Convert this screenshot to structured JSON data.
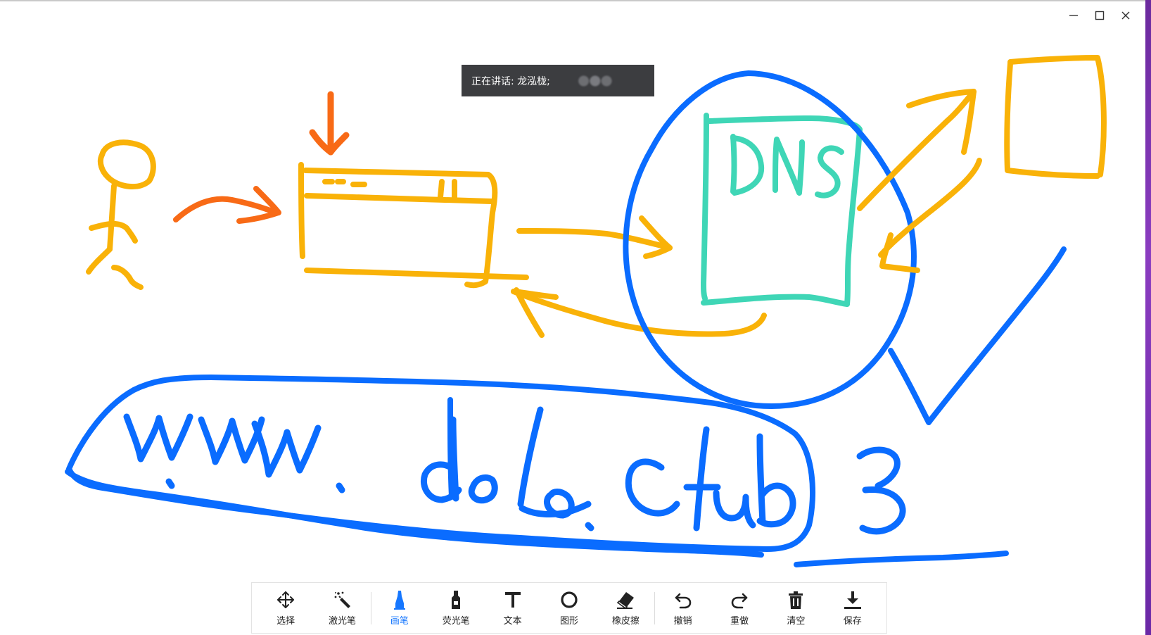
{
  "window": {
    "controls": [
      "minimize-icon",
      "maximize-icon",
      "close-icon"
    ]
  },
  "banner": {
    "speaking_label": "正在讲话: 龙泓栊;"
  },
  "colors": {
    "pen_yellow": "#f9b208",
    "pen_orange": "#f86a16",
    "pen_blue": "#0a6cff",
    "pen_teal": "#3fd6b6",
    "active_tool": "#1677ff",
    "banner_bg": "#3c3d40"
  },
  "toolbar": {
    "tools": [
      {
        "id": "select",
        "label": "选择",
        "icon": "move-arrows-icon",
        "active": false
      },
      {
        "id": "laser",
        "label": "激光笔",
        "icon": "magic-wand-icon",
        "active": false
      },
      {
        "id": "pen",
        "label": "画笔",
        "icon": "pen-icon",
        "active": true
      },
      {
        "id": "highlighter",
        "label": "荧光笔",
        "icon": "highlighter-icon",
        "active": false
      },
      {
        "id": "text",
        "label": "文本",
        "icon": "text-t-icon",
        "active": false
      },
      {
        "id": "shape",
        "label": "图形",
        "icon": "circle-shape-icon",
        "active": false
      },
      {
        "id": "eraser",
        "label": "橡皮擦",
        "icon": "eraser-icon",
        "active": false
      },
      {
        "id": "undo",
        "label": "撤销",
        "icon": "undo-icon",
        "active": false
      },
      {
        "id": "redo",
        "label": "重做",
        "icon": "redo-icon",
        "active": false
      },
      {
        "id": "clear",
        "label": "清空",
        "icon": "trash-icon",
        "active": false
      },
      {
        "id": "save",
        "label": "保存",
        "icon": "download-icon",
        "active": false
      }
    ]
  },
  "drawing": {
    "handwritten_text": "www. dolo.club 3",
    "box_label": "DNS"
  }
}
